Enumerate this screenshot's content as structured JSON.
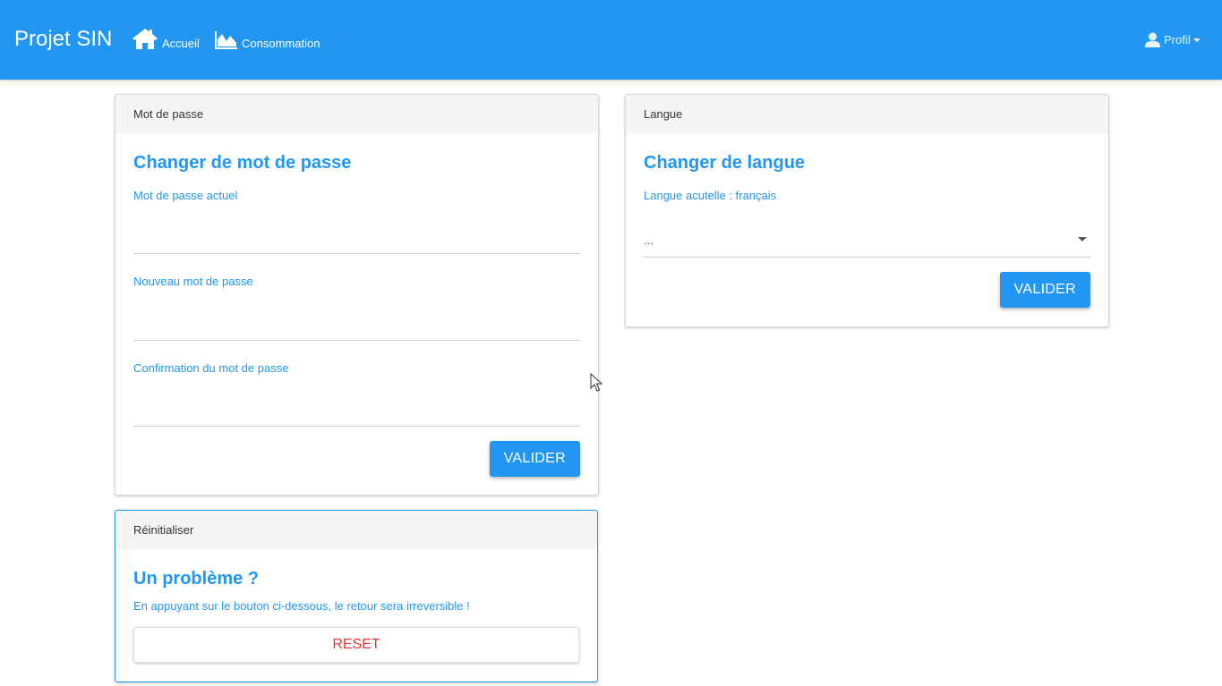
{
  "navbar": {
    "brand": "Projet SIN",
    "links": [
      {
        "label": "Accueil",
        "icon": "home-icon"
      },
      {
        "label": "Consommation",
        "icon": "area-chart-icon"
      }
    ],
    "profile_label": "Profil",
    "profile_icon": "user-icon",
    "background_color": "#2196f3"
  },
  "password_card": {
    "header": "Mot de passe",
    "title": "Changer de mot de passe",
    "fields": [
      {
        "label": "Mot de passe actuel",
        "value": ""
      },
      {
        "label": "Nouveau mot de passe",
        "value": ""
      },
      {
        "label": "Confirmation du mot de passe",
        "value": ""
      }
    ],
    "submit_label": "VALIDER"
  },
  "language_card": {
    "header": "Langue",
    "title": "Changer de langue",
    "current_language_label": "Langue acutelle : français",
    "select_value": "...",
    "submit_label": "VALIDER"
  },
  "reset_card": {
    "header": "Réinitialiser",
    "title": "Un problème ?",
    "warning": "En appuyant sur le bouton ci-dessous, le retour sera irreversible !",
    "reset_label": "RESET",
    "reset_color": "#e53935"
  },
  "accent_color": "#2196f3"
}
